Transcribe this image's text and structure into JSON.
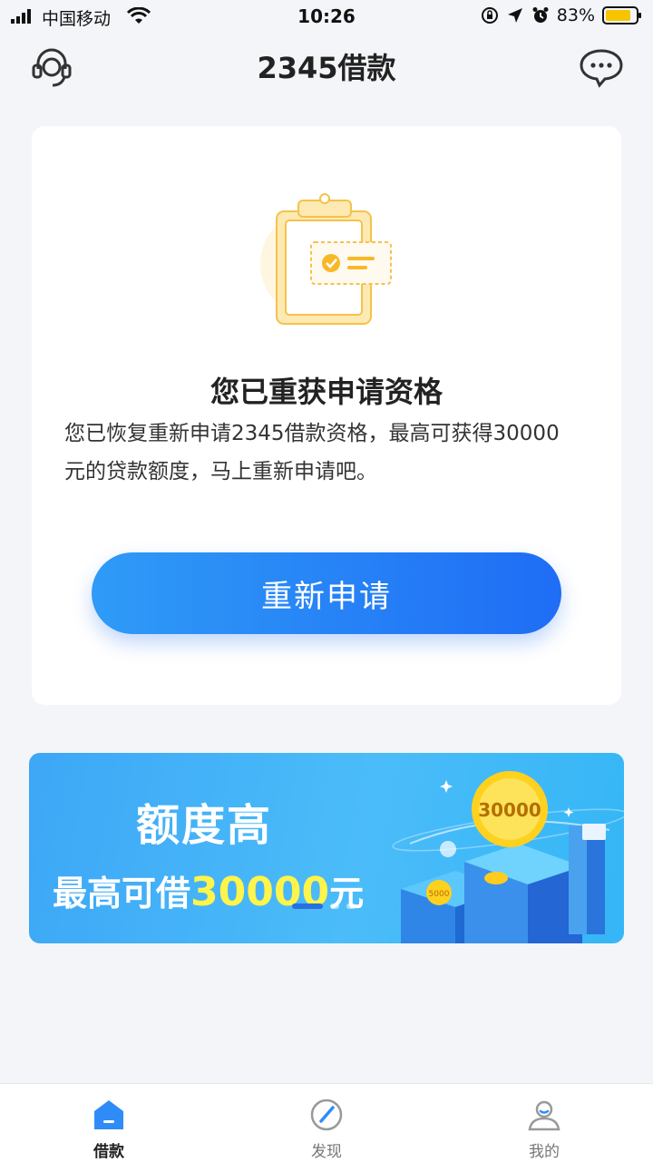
{
  "status_bar": {
    "carrier": "中国移动",
    "time": "10:26",
    "battery": "83%"
  },
  "header": {
    "title": "2345借款"
  },
  "card": {
    "title": "您已重获申请资格",
    "description": "您已恢复重新申请2345借款资格，最高可获得30000元的贷款额度，马上重新申请吧。",
    "button": "重新申请"
  },
  "banner": {
    "title": "额度高",
    "subtitle_prefix": "最高可借",
    "subtitle_amount": "30000",
    "subtitle_suffix": "元",
    "coin_big": "30000",
    "coin_small": "5000"
  },
  "bottom_nav": {
    "items": [
      {
        "label": "借款",
        "icon": "home-icon"
      },
      {
        "label": "发现",
        "icon": "compass-icon"
      },
      {
        "label": "我的",
        "icon": "user-icon"
      }
    ]
  },
  "colors": {
    "accent": "#1f6df5",
    "background": "#f4f5f9",
    "highlight": "#fff44a"
  }
}
